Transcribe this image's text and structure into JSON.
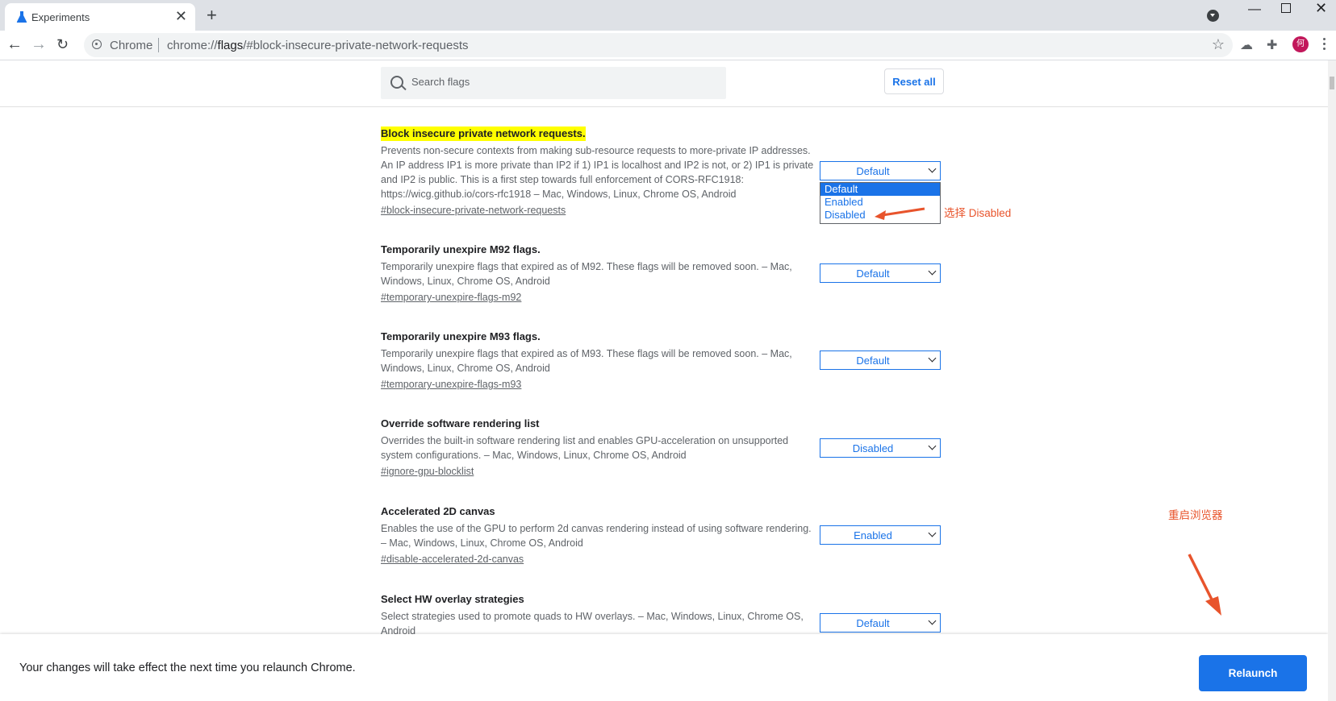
{
  "browser": {
    "tab_title": "Experiments",
    "tab_close": "✕",
    "new_tab": "+",
    "omnibox_site": "Chrome",
    "omnibox_url_prefix": "chrome://",
    "omnibox_url_host": "flags",
    "omnibox_url_rest": "/#block-insecure-private-network-requests",
    "avatar_initial": "何"
  },
  "header": {
    "search_placeholder": "Search flags",
    "reset_label": "Reset all"
  },
  "flags": [
    {
      "title": "Block insecure private network requests.",
      "description": "Prevents non-secure contexts from making sub-resource requests to more-private IP addresses. An IP address IP1 is more private than IP2 if 1) IP1 is localhost and IP2 is not, or 2) IP1 is private and IP2 is public. This is a first step towards full enforcement of CORS-RFC1918: https://wicg.github.io/cors-rfc1918 – Mac, Windows, Linux, Chrome OS, Android",
      "link": "#block-insecure-private-network-requests",
      "value": "Default"
    },
    {
      "title": "Temporarily unexpire M92 flags.",
      "description": "Temporarily unexpire flags that expired as of M92. These flags will be removed soon. – Mac, Windows, Linux, Chrome OS, Android",
      "link": "#temporary-unexpire-flags-m92",
      "value": "Default"
    },
    {
      "title": "Temporarily unexpire M93 flags.",
      "description": "Temporarily unexpire flags that expired as of M93. These flags will be removed soon. – Mac, Windows, Linux, Chrome OS, Android",
      "link": "#temporary-unexpire-flags-m93",
      "value": "Default"
    },
    {
      "title": "Override software rendering list",
      "description": "Overrides the built-in software rendering list and enables GPU-acceleration on unsupported system configurations. – Mac, Windows, Linux, Chrome OS, Android",
      "link": "#ignore-gpu-blocklist",
      "value": "Disabled"
    },
    {
      "title": "Accelerated 2D canvas",
      "description": "Enables the use of the GPU to perform 2d canvas rendering instead of using software rendering. – Mac, Windows, Linux, Chrome OS, Android",
      "link": "#disable-accelerated-2d-canvas",
      "value": "Enabled"
    },
    {
      "title": "Select HW overlay strategies",
      "description": "Select strategies used to promote quads to HW overlays. – Mac, Windows, Linux, Chrome OS, Android",
      "value": "Default"
    }
  ],
  "dropdown_options": [
    "Default",
    "Enabled",
    "Disabled"
  ],
  "dropdown_selected": "Default",
  "annotations": {
    "choose_disabled": "选择 Disabled",
    "restart_browser": "重启浏览器",
    "color": "#e8542c"
  },
  "bottom": {
    "message": "Your changes will take effect the next time you relaunch Chrome.",
    "relaunch_label": "Relaunch"
  },
  "colors": {
    "accent": "#1a73e8",
    "highlight": "#ffff00"
  }
}
